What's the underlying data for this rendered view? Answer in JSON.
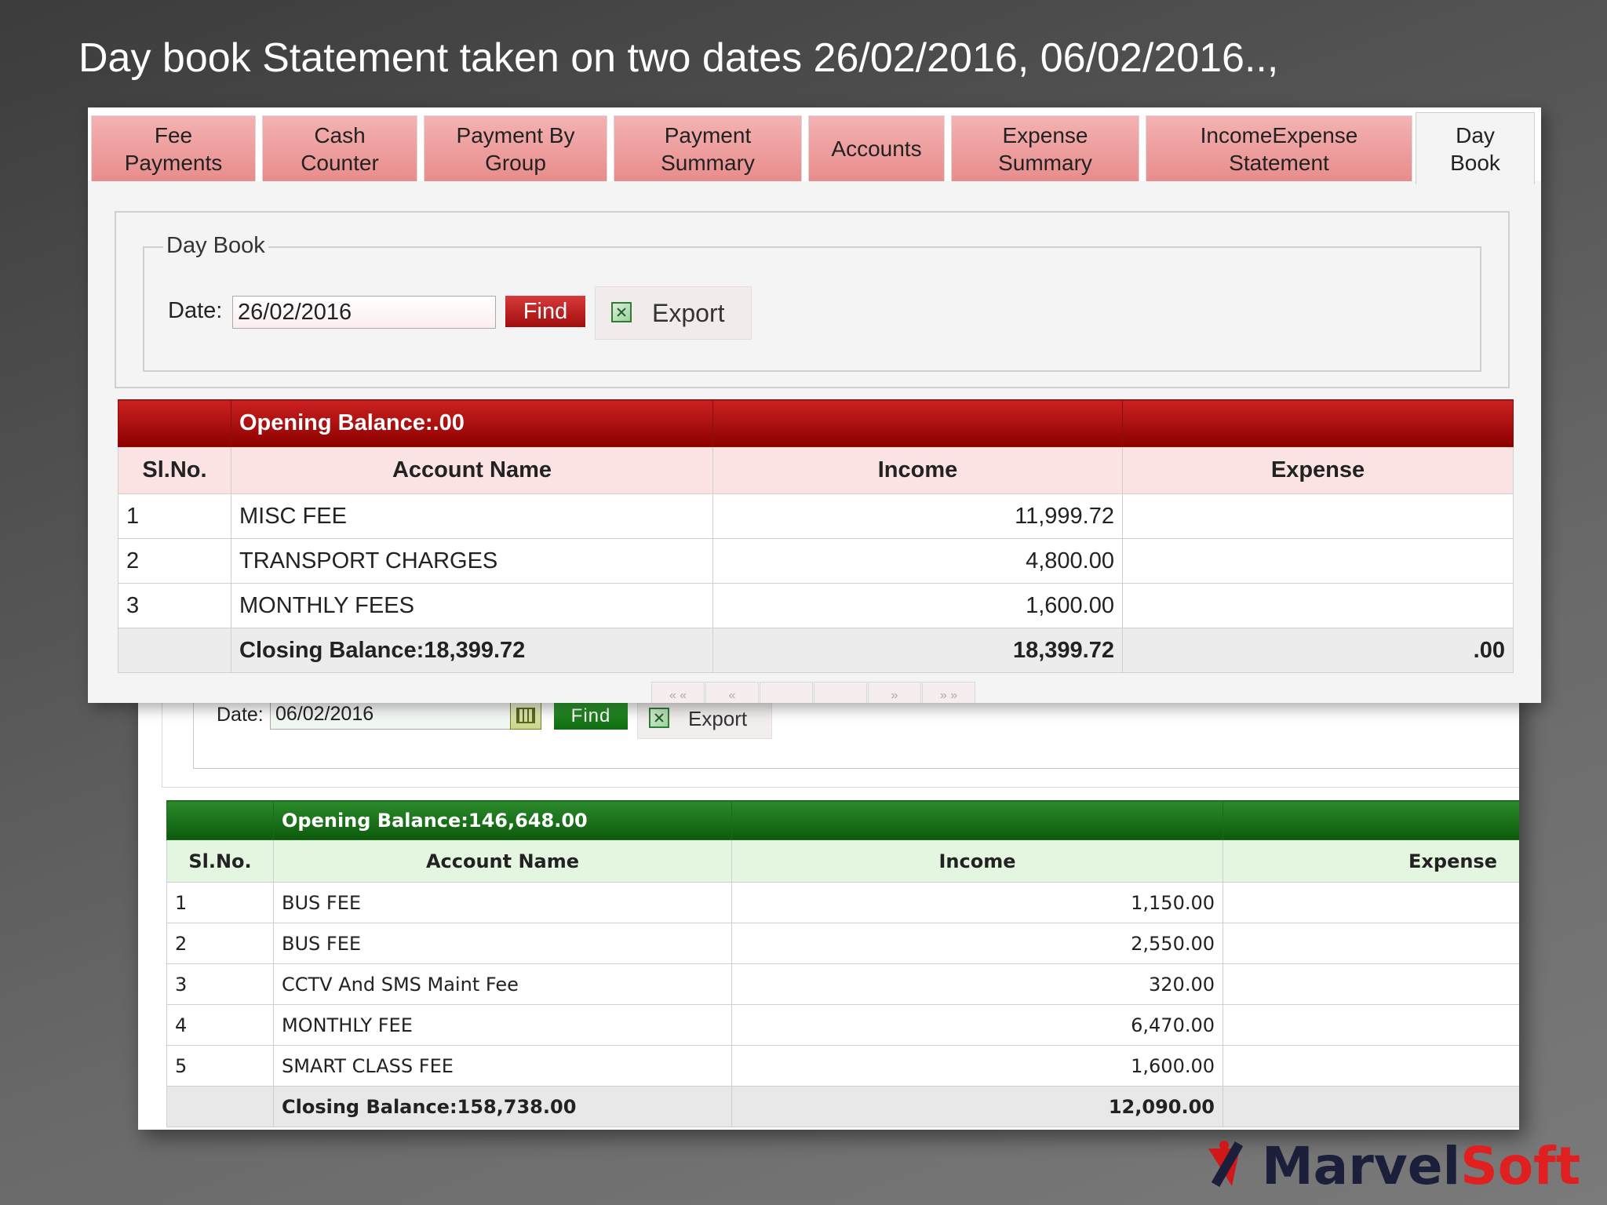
{
  "slide_title": "Day book Statement taken on two dates 26/02/2016, 06/02/2016..,",
  "tabs": [
    {
      "line1": "Fee",
      "line2": "Payments"
    },
    {
      "line1": "Cash",
      "line2": "Counter"
    },
    {
      "line1": "Payment By",
      "line2": "Group"
    },
    {
      "line1": "Payment",
      "line2": "Summary"
    },
    {
      "line1": "Accounts",
      "line2": ""
    },
    {
      "line1": "Expense",
      "line2": "Summary"
    },
    {
      "line1": "IncomeExpense",
      "line2": "Statement"
    },
    {
      "line1": "Day",
      "line2": "Book"
    }
  ],
  "day_book_first": {
    "legend": "Day Book",
    "date_label": "Date:",
    "date_value": "26/02/2016",
    "find_label": "Find",
    "export_label": "Export",
    "opening_balance": "Opening Balance:.00",
    "columns": [
      "Sl.No.",
      "Account Name",
      "Income",
      "Expense"
    ],
    "rows": [
      {
        "sl": "1",
        "account": "MISC FEE",
        "income": "11,999.72",
        "expense": ""
      },
      {
        "sl": "2",
        "account": "TRANSPORT CHARGES",
        "income": "4,800.00",
        "expense": ""
      },
      {
        "sl": "3",
        "account": "MONTHLY FEES",
        "income": "1,600.00",
        "expense": ""
      }
    ],
    "closing_balance": "Closing Balance:18,399.72",
    "total_income": "18,399.72",
    "total_expense": ".00",
    "pager": [
      "« «",
      "«",
      "",
      "",
      "»",
      "» »"
    ]
  },
  "day_book_second": {
    "date_label": "Date:",
    "date_value": "06/02/2016",
    "find_label": "Find",
    "export_label": "Export",
    "opening_balance": "Opening Balance:146,648.00",
    "columns": [
      "Sl.No.",
      "Account Name",
      "Income",
      "Expense"
    ],
    "rows": [
      {
        "sl": "1",
        "account": "BUS FEE",
        "income": "1,150.00",
        "expense": ""
      },
      {
        "sl": "2",
        "account": "BUS FEE",
        "income": "2,550.00",
        "expense": ""
      },
      {
        "sl": "3",
        "account": "CCTV And SMS Maint Fee",
        "income": "320.00",
        "expense": ""
      },
      {
        "sl": "4",
        "account": "MONTHLY FEE",
        "income": "6,470.00",
        "expense": ""
      },
      {
        "sl": "5",
        "account": "SMART CLASS FEE",
        "income": "1,600.00",
        "expense": ""
      }
    ],
    "closing_balance": "Closing Balance:158,738.00",
    "total_income": "12,090.00",
    "total_expense": ""
  },
  "logo": {
    "part1": "Marvel",
    "part2": "Soft"
  },
  "colors": {
    "red_header": "#b01010",
    "green_header": "#1b7a1b",
    "tab_pink": "#f0a0a0",
    "logo_navy": "#1b1f3a",
    "logo_red": "#e02020"
  }
}
